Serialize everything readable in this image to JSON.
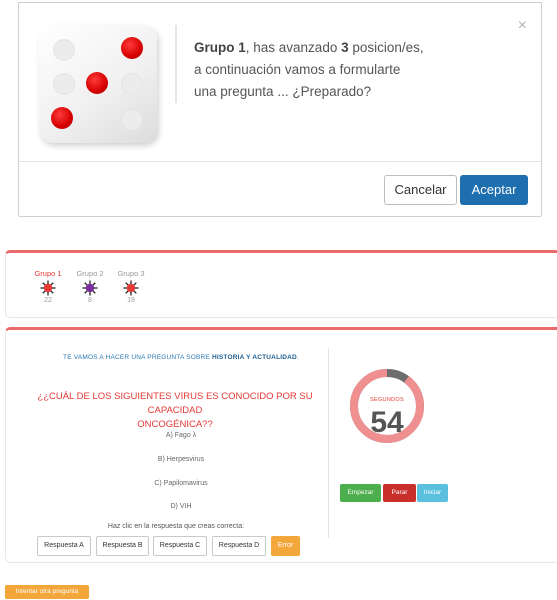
{
  "modal": {
    "group_label": "Grupo 1",
    "text_part1": ", has avanzado ",
    "positions": "3",
    "text_part2": " posicion/es,",
    "line2": "a continuación vamos a formularte",
    "line3": "una pregunta ... ¿Preparado?",
    "close_icon": "×",
    "cancel_label": "Cancelar",
    "accept_label": "Aceptar",
    "dice_value": 3,
    "pip_color": "#d60000"
  },
  "groups": [
    {
      "name": "Grupo 1",
      "score": "22",
      "active": true,
      "icon_color": "#e53935"
    },
    {
      "name": "Grupo 2",
      "score": "8",
      "active": false,
      "icon_color": "#7b2ea0"
    },
    {
      "name": "Grupo 3",
      "score": "19",
      "active": false,
      "icon_color": "#e53935"
    }
  ],
  "question_panel": {
    "intro_prefix": "TE VAMOS A HACER UNA PREGUNTA SOBRE ",
    "intro_topic": "HISTORIA Y ACTUALIDAD",
    "intro_suffix": ".",
    "question_line1": "¿¿CUÁL DE LOS SIGUIENTES VIRUS ES CONOCIDO POR SU CAPACIDAD",
    "question_line2": "ONCOGÉNICA??",
    "options": [
      {
        "label": "A) Fago λ"
      },
      {
        "label": "B) Herpesvirus"
      },
      {
        "label": "C) Papilomavirus"
      },
      {
        "label": "D) VIH"
      }
    ],
    "hint": "Haz clic en la respuesta que creas correcta:",
    "answers": [
      {
        "label": "Respuesta A"
      },
      {
        "label": "Respuesta B"
      },
      {
        "label": "Respuesta C"
      },
      {
        "label": "Respuesta D"
      },
      {
        "label": "Error"
      }
    ]
  },
  "timer": {
    "label": "SEGUNDOS",
    "value": "54",
    "remaining_fraction": 0.9,
    "ring_color": "#f08f8f",
    "elapsed_color": "#6e6e6e"
  },
  "controls": {
    "start_label": "Empezar",
    "stop_label": "Parar",
    "reset_label": "Iniciar"
  },
  "retry_label": "Intentar otra pregunta",
  "colors": {
    "accent_red": "#e53935",
    "primary_blue": "#1e6fb0",
    "warning_orange": "#f3a73b",
    "success_green": "#4cae4c",
    "danger_red": "#c9302c",
    "info_blue": "#5bc0de"
  }
}
